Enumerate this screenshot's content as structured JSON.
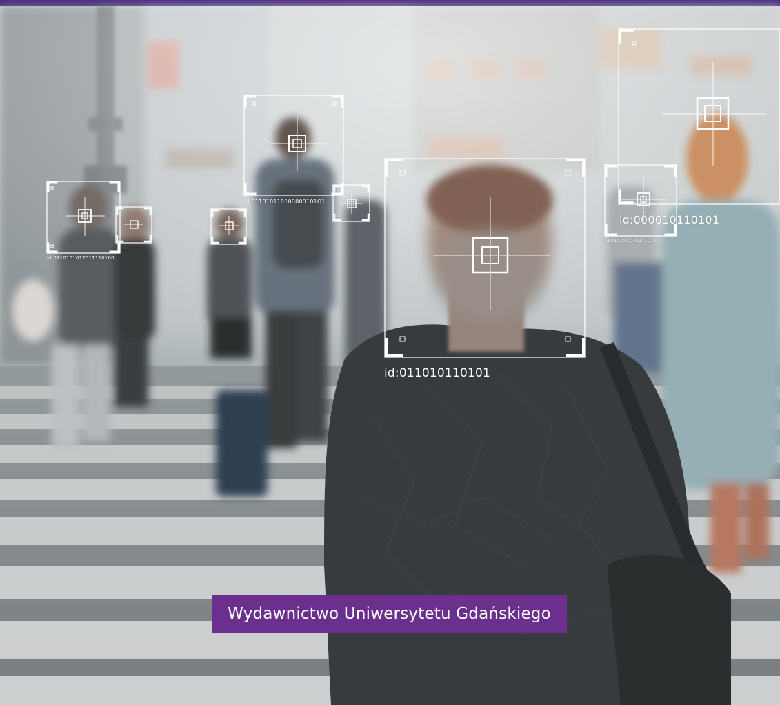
{
  "colors": {
    "top_bar": "#4b2a82",
    "banner": "#6b2f8e",
    "overlay": "#ffffff"
  },
  "banner": {
    "text": "Wydawnictwo Uniwersytetu Gdańskiego"
  },
  "face_ids": {
    "main": "id:011010110101",
    "right": "id:000010110101",
    "backpack": "id:011010110100000101O1",
    "left": "id:0110101012011110100",
    "small_right": "id:0101010101111O100"
  }
}
